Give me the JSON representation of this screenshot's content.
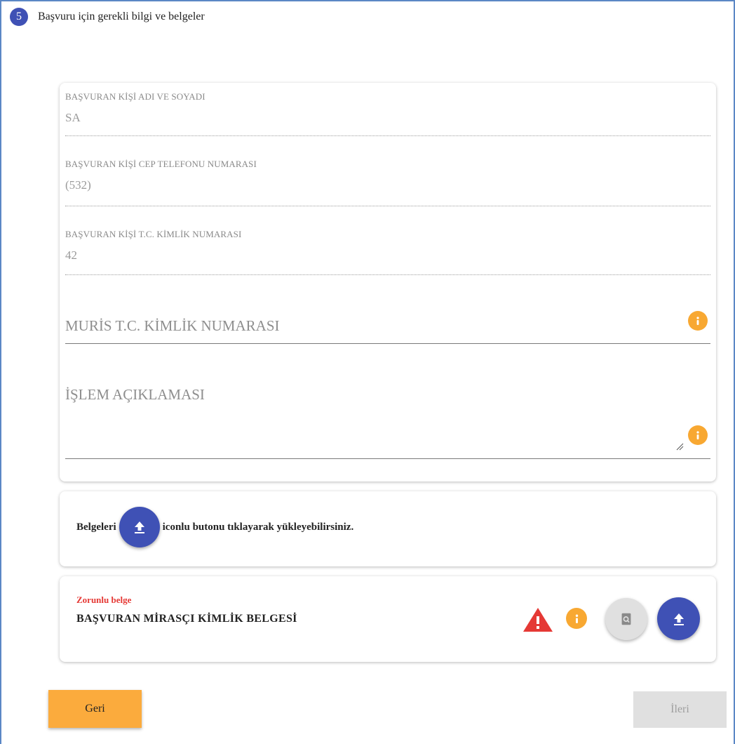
{
  "step": {
    "number": "5",
    "title": "Başvuru için gerekli bilgi ve belgeler"
  },
  "form": {
    "applicant_name": {
      "label": "BAŞVURAN KİŞİ ADI VE SOYADI",
      "value": "SA"
    },
    "applicant_phone": {
      "label": "BAŞVURAN KİŞİ CEP TELEFONU NUMARASI",
      "value": "(532)"
    },
    "applicant_tc": {
      "label": "BAŞVURAN KİŞİ T.C. KİMLİK NUMARASI",
      "value": "42"
    },
    "muris_tc": {
      "placeholder": "MURİS T.C. KİMLİK NUMARASI"
    },
    "description": {
      "placeholder": "İŞLEM AÇIKLAMASI"
    }
  },
  "upload_info": {
    "before": "Belgeleri",
    "after": "iconlu butonu tıklayarak yükleyebilirsiniz."
  },
  "document": {
    "required_label": "Zorunlu belge",
    "name": "BAŞVURAN MİRASÇI KİMLİK BELGESİ"
  },
  "nav": {
    "back_label": "Geri",
    "next_label": "İleri"
  },
  "colors": {
    "primary": "#3f51b5",
    "accent_orange": "#f8a832",
    "warning_red": "#e53935",
    "disabled_gray": "#e0e0e0"
  },
  "icons": {
    "upload": "upload-icon",
    "info": "info-icon",
    "warning": "warning-icon",
    "preview": "document-search-icon",
    "resize": "resize-handle-icon"
  }
}
